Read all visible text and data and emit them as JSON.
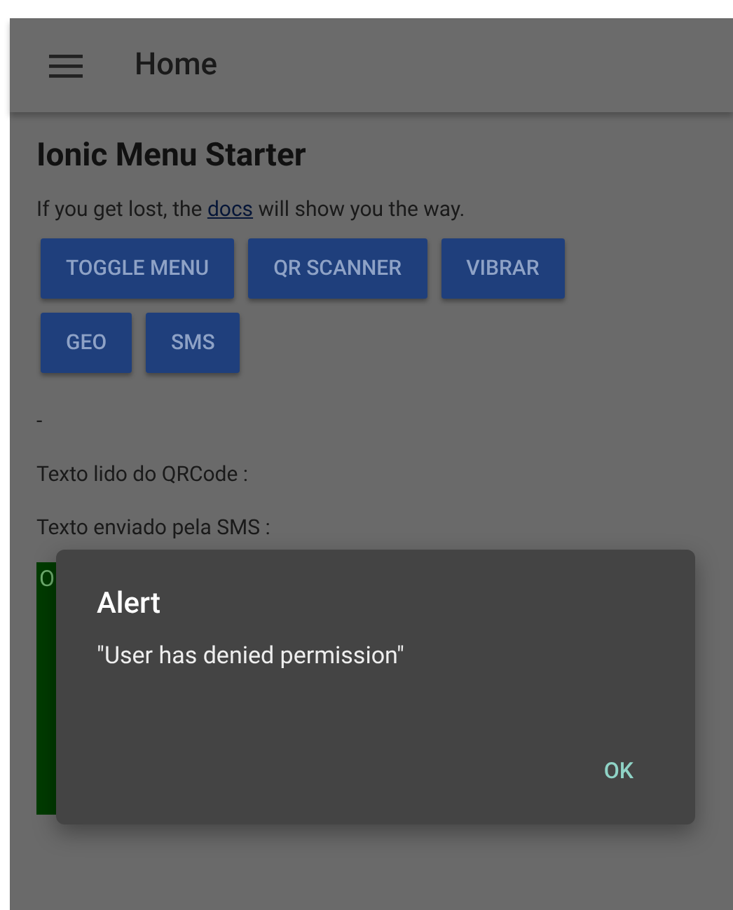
{
  "header": {
    "title": "Home"
  },
  "content": {
    "title": "Ionic Menu Starter",
    "intro_before": "If you get lost, the",
    "intro_link": "docs",
    "intro_after": "will show you the way.",
    "buttons": [
      "TOGGLE MENU",
      "QR SCANNER",
      "VIBRAR",
      "GEO",
      "SMS"
    ],
    "lines": [
      "-",
      "Texto lido do QRCode :",
      "Texto enviado pela SMS :"
    ],
    "green_box": {
      "text": "O"
    }
  },
  "alert": {
    "title": "Alert",
    "message": "\"User has denied permission\"",
    "buttons": [
      "OK"
    ]
  }
}
